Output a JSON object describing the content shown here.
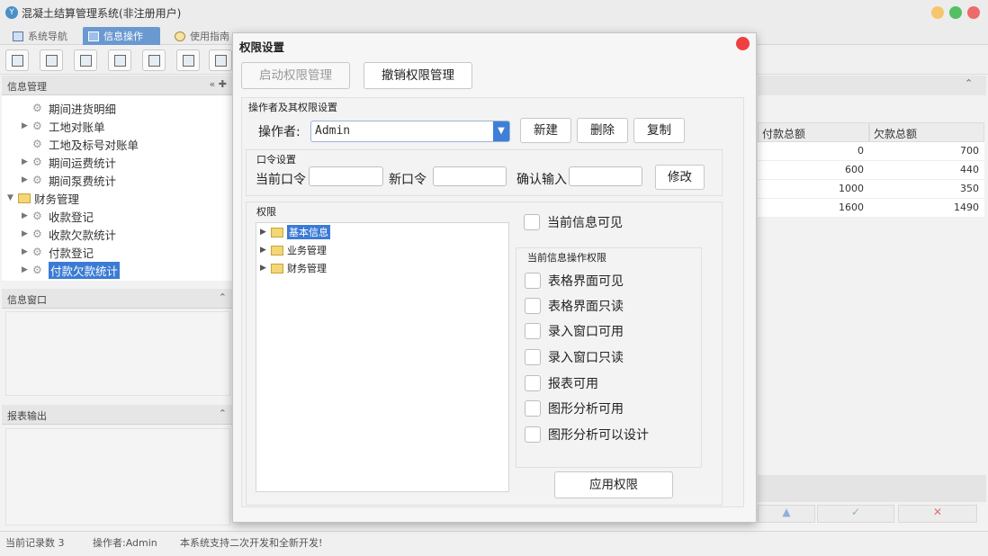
{
  "app": {
    "title": "混凝土结算管理系统(非注册用户)"
  },
  "window_controls": {
    "colors": [
      "#f5c66b",
      "#55c062",
      "#ef6b6b"
    ]
  },
  "tabs": [
    {
      "label": "系统导航"
    },
    {
      "label": "信息操作"
    },
    {
      "label": "使用指南"
    }
  ],
  "left": {
    "info_panel_title": "信息管理",
    "info_window_title": "信息窗口",
    "report_title": "报表输出",
    "tree": [
      {
        "label": "期间进货明细"
      },
      {
        "label": "工地对账单"
      },
      {
        "label": "工地及标号对账单"
      },
      {
        "label": "期间运费统计"
      },
      {
        "label": "期间泵费统计"
      },
      {
        "label": "财务管理"
      },
      {
        "label": "收款登记"
      },
      {
        "label": "收款欠款统计"
      },
      {
        "label": "付款登记"
      },
      {
        "label": "付款欠款统计"
      }
    ]
  },
  "grid": {
    "headers": [
      "付款总额",
      "欠款总额"
    ],
    "rows": [
      [
        "0",
        "700"
      ],
      [
        "600",
        "440"
      ],
      [
        "1000",
        "350"
      ],
      [
        "1600",
        "1490"
      ]
    ]
  },
  "nav_buttons": [
    "▲",
    "✓",
    "✕"
  ],
  "status": {
    "records": "当前记录数 3",
    "operator": "操作者:Admin",
    "message": "本系统支持二次开发和全新开发!"
  },
  "dialog": {
    "title": "权限设置",
    "enable_btn": "启动权限管理",
    "revoke_btn": "撤销权限管理",
    "operator_group": "操作者及其权限设置",
    "operator_label": "操作者:",
    "operator_value": "Admin",
    "new_btn": "新建",
    "delete_btn": "删除",
    "copy_btn": "复制",
    "password_group": "口令设置",
    "current_pwd": "当前口令",
    "new_pwd": "新口令",
    "confirm_pwd": "确认输入",
    "modify_btn": "修改",
    "perm_group": "权限",
    "perm_tree": [
      "基本信息",
      "业务管理",
      "财务管理"
    ],
    "visible_check": "当前信息可见",
    "ops_group": "当前信息操作权限",
    "ops": [
      "表格界面可见",
      "表格界面只读",
      "录入窗口可用",
      "录入窗口只读",
      "报表可用",
      "图形分析可用",
      "图形分析可以设计"
    ],
    "apply_btn": "应用权限"
  }
}
